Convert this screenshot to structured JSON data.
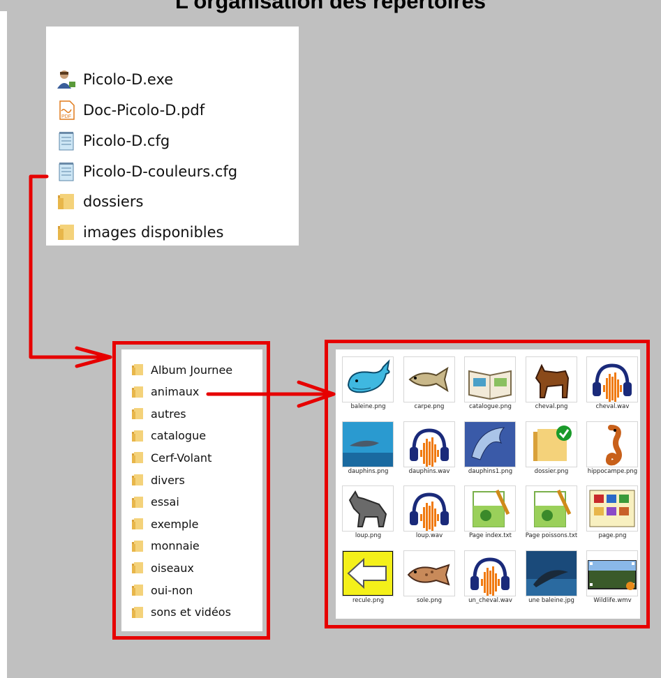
{
  "title": "L'organisation des répertoires",
  "top_files": [
    {
      "name": "Picolo-D.exe",
      "icon": "app-user-icon"
    },
    {
      "name": "Doc-Picolo-D.pdf",
      "icon": "pdf-icon"
    },
    {
      "name": "Picolo-D.cfg",
      "icon": "notepad-icon"
    },
    {
      "name": "Picolo-D-couleurs.cfg",
      "icon": "notepad-icon"
    },
    {
      "name": "dossiers",
      "icon": "folder-icon"
    },
    {
      "name": "images disponibles",
      "icon": "folder-icon"
    }
  ],
  "folders": [
    "Album Journee",
    "animaux",
    "autres",
    "catalogue",
    "Cerf-Volant",
    "divers",
    "essai",
    "exemple",
    "monnaie",
    "oiseaux",
    "oui-non",
    "sons et vidéos"
  ],
  "files": [
    {
      "name": "baleine.png",
      "icon": "whale-icon"
    },
    {
      "name": "carpe.png",
      "icon": "fish-icon"
    },
    {
      "name": "catalogue.png",
      "icon": "book-icon"
    },
    {
      "name": "cheval.png",
      "icon": "horse-icon"
    },
    {
      "name": "cheval.wav",
      "icon": "audio-icon"
    },
    {
      "name": "dauphins.png",
      "icon": "dolphins-photo-icon"
    },
    {
      "name": "dauphins.wav",
      "icon": "audio-icon"
    },
    {
      "name": "dauphins1.png",
      "icon": "dolphin-icon"
    },
    {
      "name": "dossier.png",
      "icon": "folder-check-icon"
    },
    {
      "name": "hippocampe.png",
      "icon": "seahorse-icon"
    },
    {
      "name": "loup.png",
      "icon": "wolf-icon"
    },
    {
      "name": "loup.wav",
      "icon": "audio-icon"
    },
    {
      "name": "Page index.txt",
      "icon": "notepad-plus-icon"
    },
    {
      "name": "Page poissons.txt",
      "icon": "notepad-plus-icon"
    },
    {
      "name": "page.png",
      "icon": "page-icon"
    },
    {
      "name": "recule.png",
      "icon": "back-arrow-icon"
    },
    {
      "name": "sole.png",
      "icon": "flatfish-icon"
    },
    {
      "name": "un_cheval.wav",
      "icon": "audio-icon"
    },
    {
      "name": "une baleine.jpg",
      "icon": "whale-photo-icon"
    },
    {
      "name": "Wildlife.wmv",
      "icon": "video-icon"
    }
  ],
  "colors": {
    "background": "#c0c0c0",
    "accent_red": "#e60000",
    "folder": "#e8b64a"
  }
}
